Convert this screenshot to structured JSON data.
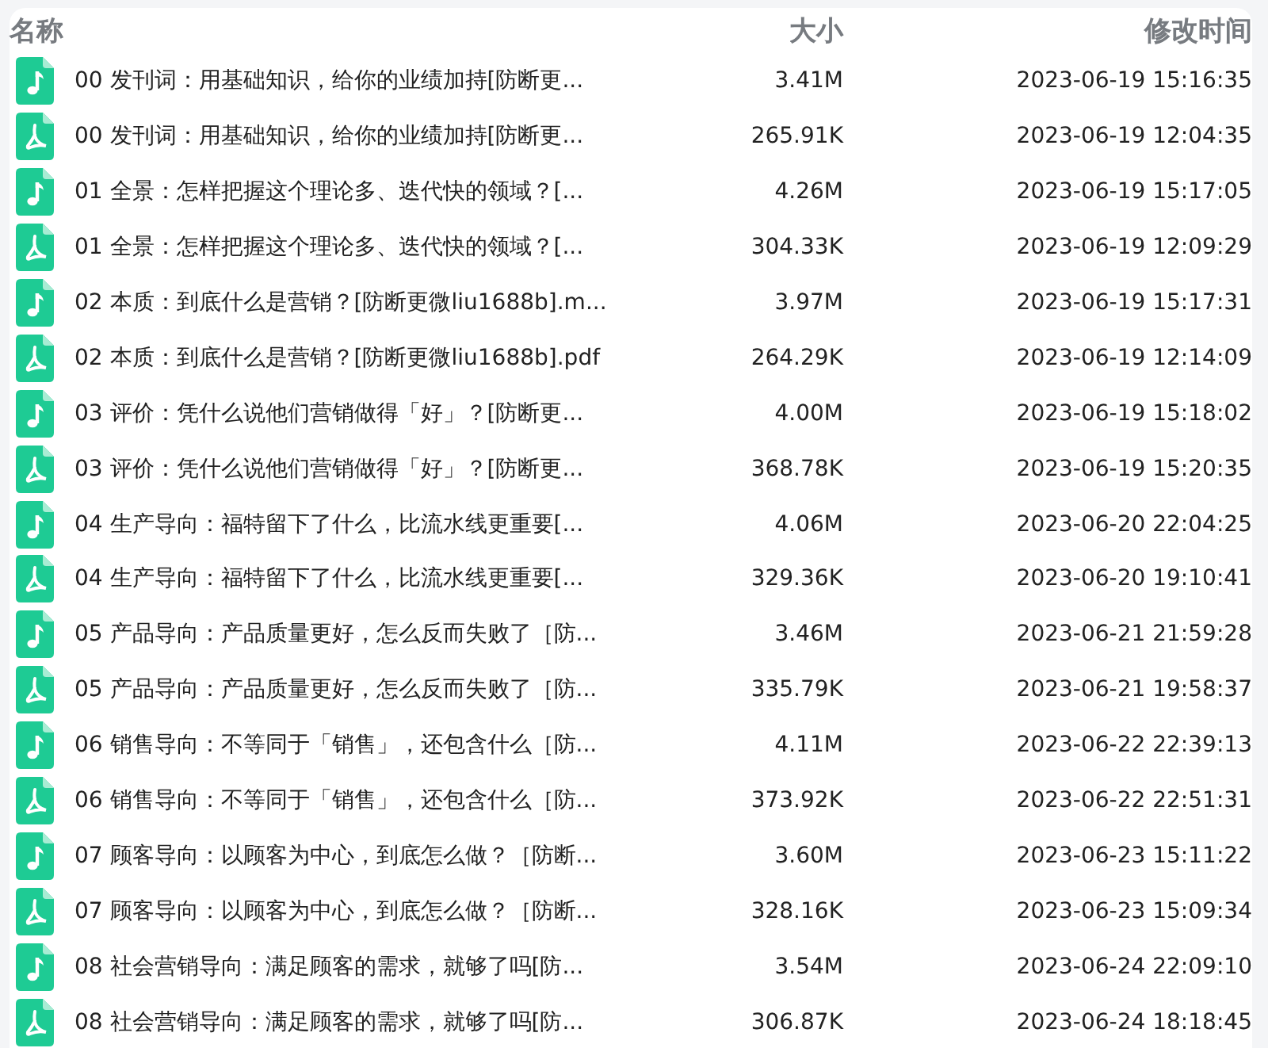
{
  "columns": [
    {
      "label": "名称"
    },
    {
      "label": "大小"
    },
    {
      "label": "修改时间"
    }
  ],
  "files": [
    {
      "kind": "audio",
      "name": "00 发刊词：用基础知识，给你的业绩加持[防断更...",
      "size": "3.41M",
      "modified": "2023-06-19 15:16:35"
    },
    {
      "kind": "pdf",
      "name": "00 发刊词：用基础知识，给你的业绩加持[防断更...",
      "size": "265.91K",
      "modified": "2023-06-19 12:04:35"
    },
    {
      "kind": "audio",
      "name": "01 全景：怎样把握这个理论多、迭代快的领域？[...",
      "size": "4.26M",
      "modified": "2023-06-19 15:17:05"
    },
    {
      "kind": "pdf",
      "name": "01 全景：怎样把握这个理论多、迭代快的领域？[...",
      "size": "304.33K",
      "modified": "2023-06-19 12:09:29"
    },
    {
      "kind": "audio",
      "name": "02 本质：到底什么是营销？[防断更微liu1688b].m...",
      "size": "3.97M",
      "modified": "2023-06-19 15:17:31"
    },
    {
      "kind": "pdf",
      "name": "02 本质：到底什么是营销？[防断更微liu1688b].pdf",
      "size": "264.29K",
      "modified": "2023-06-19 12:14:09"
    },
    {
      "kind": "audio",
      "name": "03 评价：凭什么说他们营销做得「好」？[防断更...",
      "size": "4.00M",
      "modified": "2023-06-19 15:18:02"
    },
    {
      "kind": "pdf",
      "name": "03 评价：凭什么说他们营销做得「好」？[防断更...",
      "size": "368.78K",
      "modified": "2023-06-19 15:20:35"
    },
    {
      "kind": "audio",
      "name": "04 生产导向：福特留下了什么，比流水线更重要[...",
      "size": "4.06M",
      "modified": "2023-06-20 22:04:25"
    },
    {
      "kind": "pdf",
      "name": "04 生产导向：福特留下了什么，比流水线更重要[...",
      "size": "329.36K",
      "modified": "2023-06-20 19:10:41"
    },
    {
      "kind": "audio",
      "name": "05 产品导向：产品质量更好，怎么反而失败了［防...",
      "size": "3.46M",
      "modified": "2023-06-21 21:59:28"
    },
    {
      "kind": "pdf",
      "name": "05 产品导向：产品质量更好，怎么反而失败了［防...",
      "size": "335.79K",
      "modified": "2023-06-21 19:58:37"
    },
    {
      "kind": "audio",
      "name": "06 销售导向：不等同于「销售」，还包含什么［防...",
      "size": "4.11M",
      "modified": "2023-06-22 22:39:13"
    },
    {
      "kind": "pdf",
      "name": "06 销售导向：不等同于「销售」，还包含什么［防...",
      "size": "373.92K",
      "modified": "2023-06-22 22:51:31"
    },
    {
      "kind": "audio",
      "name": "07 顾客导向：以顾客为中心，到底怎么做？［防断...",
      "size": "3.60M",
      "modified": "2023-06-23 15:11:22"
    },
    {
      "kind": "pdf",
      "name": "07 顾客导向：以顾客为中心，到底怎么做？［防断...",
      "size": "328.16K",
      "modified": "2023-06-23 15:09:34"
    },
    {
      "kind": "audio",
      "name": "08 社会营销导向：满足顾客的需求，就够了吗[防...",
      "size": "3.54M",
      "modified": "2023-06-24 22:09:10"
    },
    {
      "kind": "pdf",
      "name": "08 社会营销导向：满足顾客的需求，就够了吗[防...",
      "size": "306.87K",
      "modified": "2023-06-24 18:18:45"
    }
  ]
}
